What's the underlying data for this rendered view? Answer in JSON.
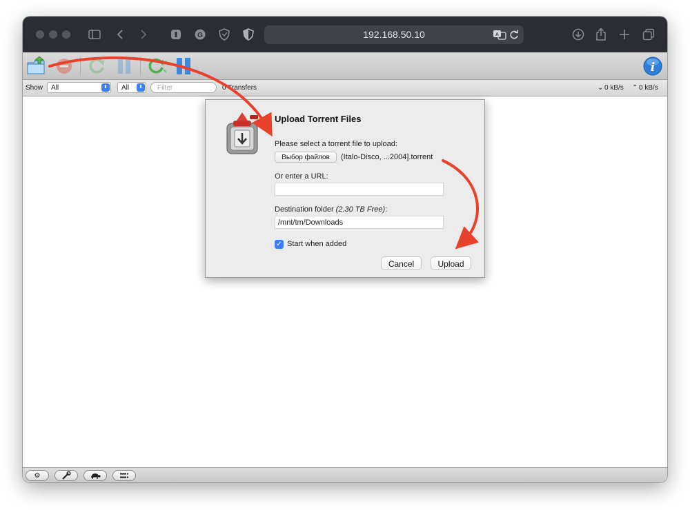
{
  "browser": {
    "url": "192.168.50.10"
  },
  "filterbar": {
    "show_label": "Show",
    "state_select": "All",
    "tracker_select": "All",
    "filter_placeholder": "Filter",
    "transfers": "0 Transfers",
    "down_speed": "0 kB/s",
    "up_speed": "0 kB/s"
  },
  "dialog": {
    "title": "Upload Torrent Files",
    "file_label": "Please select a torrent file to upload:",
    "file_button": "Выбор файлов",
    "file_name": "(Italo-Disco, ...2004].torrent",
    "url_label": "Or enter a URL:",
    "url_value": "",
    "dest_label": "Destination folder",
    "dest_free": "(2.30 TB Free)",
    "dest_colon": ":",
    "dest_value": "/mnt/tm/Downloads",
    "start_label": "Start when added",
    "start_checked": true,
    "cancel_label": "Cancel",
    "upload_label": "Upload"
  },
  "colors": {
    "accent": "#3b7ef6",
    "annotation": "#e8412c"
  }
}
